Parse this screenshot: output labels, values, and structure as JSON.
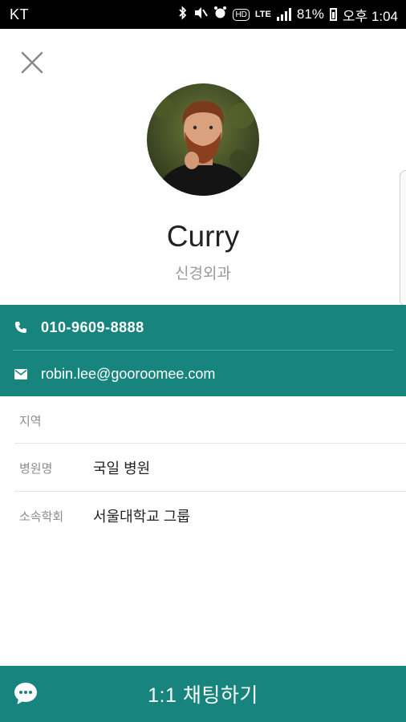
{
  "status_bar": {
    "carrier": "KT",
    "battery": "81%",
    "time": "오후 1:04",
    "icons": [
      "bluetooth-icon",
      "mute-icon",
      "alarm-icon",
      "hd-icon",
      "lte-icon",
      "signal-icon",
      "battery-icon"
    ],
    "lte_label": "LTE",
    "hd_label": "HD"
  },
  "profile": {
    "name": "Curry",
    "department": "신경외과"
  },
  "contact": {
    "phone": "010-9609-8888",
    "email": "robin.lee@gooroomee.com"
  },
  "info": [
    {
      "label": "지역",
      "value": ""
    },
    {
      "label": "병원명",
      "value": "국일 병원"
    },
    {
      "label": "소속학회",
      "value": "서울대학교 그룹"
    }
  ],
  "chat_button": {
    "label": "1:1 채팅하기"
  },
  "colors": {
    "accent": "#17857d",
    "status_bar": "#000000"
  }
}
